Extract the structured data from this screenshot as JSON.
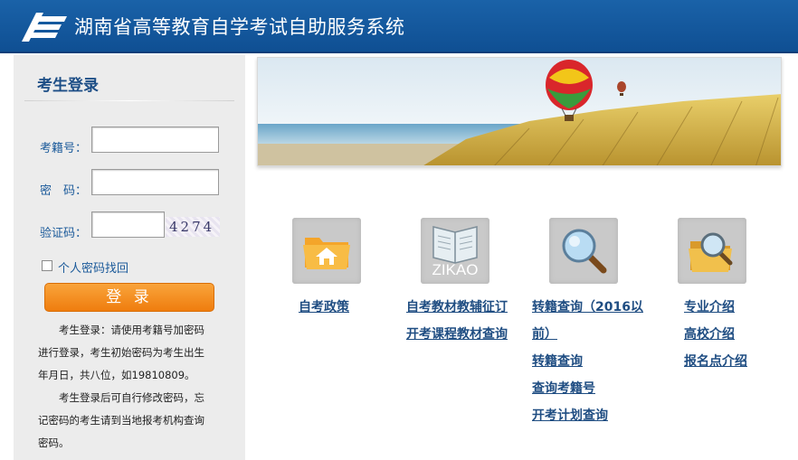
{
  "header": {
    "title": "湖南省高等教育自学考试自助服务系统"
  },
  "login": {
    "title": "考生登录",
    "exam_id_label": "考籍号：",
    "password_label": "密　码：",
    "captcha_label": "验证码：",
    "captcha_text": "4274",
    "recover_label": "个人密码找回",
    "login_button": "登 录",
    "notice_1_line_1": "　　考生登录：请使用考籍号加密码",
    "notice_1_line_2": "进行登录，考生初始密码为考生出生",
    "notice_1_line_3": "年月日，共八位，如19810809。",
    "notice_2_line_1": "　　考生登录后可自行修改密码，忘",
    "notice_2_line_2": "记密码的考生请到当地报考机构查询",
    "notice_2_line_3": "密码。"
  },
  "tiles": {
    "policy_icon": "folder-home-icon",
    "zikao_icon": "zikao-book-icon",
    "zikao_text": "ZIKAO",
    "search_icon": "magnifier-icon",
    "folder_search_icon": "folder-search-icon"
  },
  "links": {
    "policy": "自考政策",
    "textbook_solicit": "自考教材教辅征订",
    "course_textbook": "开考课程教材查询",
    "transfer_pre2016_line1": "转籍查询（2016以",
    "transfer_pre2016_line2": "前）",
    "transfer_query": "转籍查询",
    "exam_id_query": "查询考籍号",
    "plan_query": "开考计划查询",
    "major_intro": "专业介绍",
    "school_intro": "高校介绍",
    "site_intro": "报名点介绍"
  }
}
